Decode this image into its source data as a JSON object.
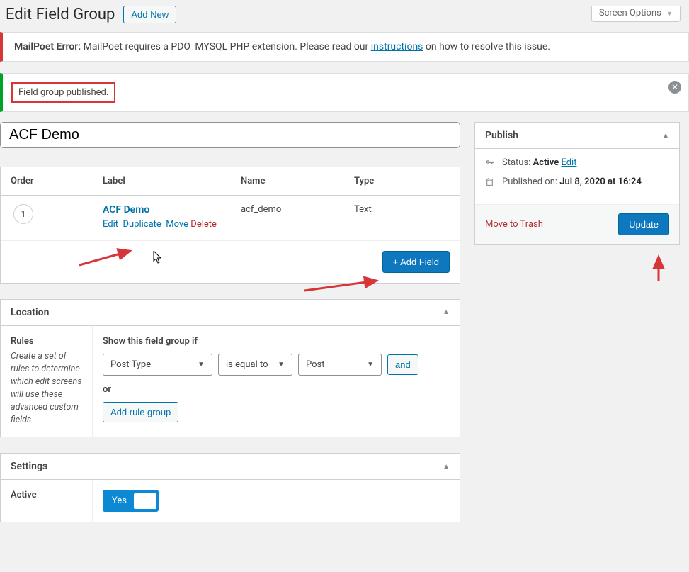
{
  "screen_options": "Screen Options",
  "page_title": "Edit Field Group",
  "add_new": "Add New",
  "error": {
    "label": "MailPoet Error:",
    "pre": " MailPoet requires a PDO_MYSQL PHP extension. Please read our ",
    "link": "instructions",
    "post": " on how to resolve this issue."
  },
  "notice": "Field group published.",
  "title_value": "ACF Demo",
  "fields_table": {
    "headers": {
      "order": "Order",
      "label": "Label",
      "name": "Name",
      "type": "Type"
    },
    "row": {
      "order": "1",
      "label": "ACF Demo",
      "name": "acf_demo",
      "type": "Text",
      "actions": {
        "edit": "Edit",
        "duplicate": "Duplicate",
        "move": "Move",
        "delete": "Delete"
      }
    },
    "add_field": "+ Add Field"
  },
  "location": {
    "title": "Location",
    "rules_label": "Rules",
    "rules_desc": "Create a set of rules to determine which edit screens will use these advanced custom fields",
    "prompt": "Show this field group if",
    "param": "Post Type",
    "operator": "is equal to",
    "value": "Post",
    "and": "and",
    "or": "or",
    "add_rule_group": "Add rule group"
  },
  "settings": {
    "title": "Settings",
    "active_label": "Active",
    "active_value": "Yes"
  },
  "publish": {
    "title": "Publish",
    "status_label": "Status:",
    "status_value": "Active",
    "edit": "Edit",
    "published_label": "Published on:",
    "published_value": "Jul 8, 2020 at 16:24",
    "trash": "Move to Trash",
    "update": "Update"
  }
}
